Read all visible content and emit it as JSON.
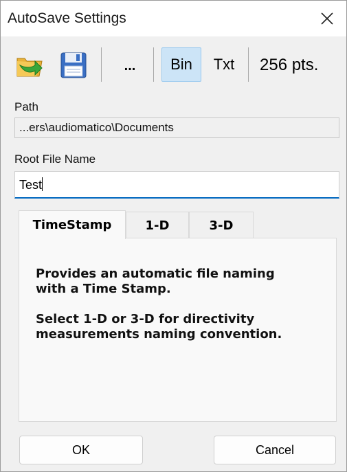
{
  "window": {
    "title": "AutoSave Settings"
  },
  "toolbar": {
    "open_folder_icon": "folder-green-arrow-icon",
    "save_icon": "floppy-disk-icon",
    "browse_label": "...",
    "bin_label": "Bin",
    "txt_label": "Txt",
    "points_label": "256 pts.",
    "selected_format": "Bin"
  },
  "path": {
    "label": "Path",
    "value": "...ers\\audiomatico\\Documents"
  },
  "root_file_name": {
    "label": "Root File Name",
    "value": "Test"
  },
  "tabs": {
    "items": [
      {
        "label": "TimeStamp"
      },
      {
        "label": "1-D"
      },
      {
        "label": "3-D"
      }
    ],
    "active": "TimeStamp",
    "content": {
      "line1": "Provides an automatic file naming",
      "line2": "with a Time Stamp.",
      "line3": "Select 1-D or 3-D for directivity",
      "line4": "measurements naming convention."
    }
  },
  "buttons": {
    "ok": "OK",
    "cancel": "Cancel"
  },
  "colors": {
    "accent": "#0067c0",
    "selected": "#cce4f7",
    "background": "#f0f0f0"
  }
}
